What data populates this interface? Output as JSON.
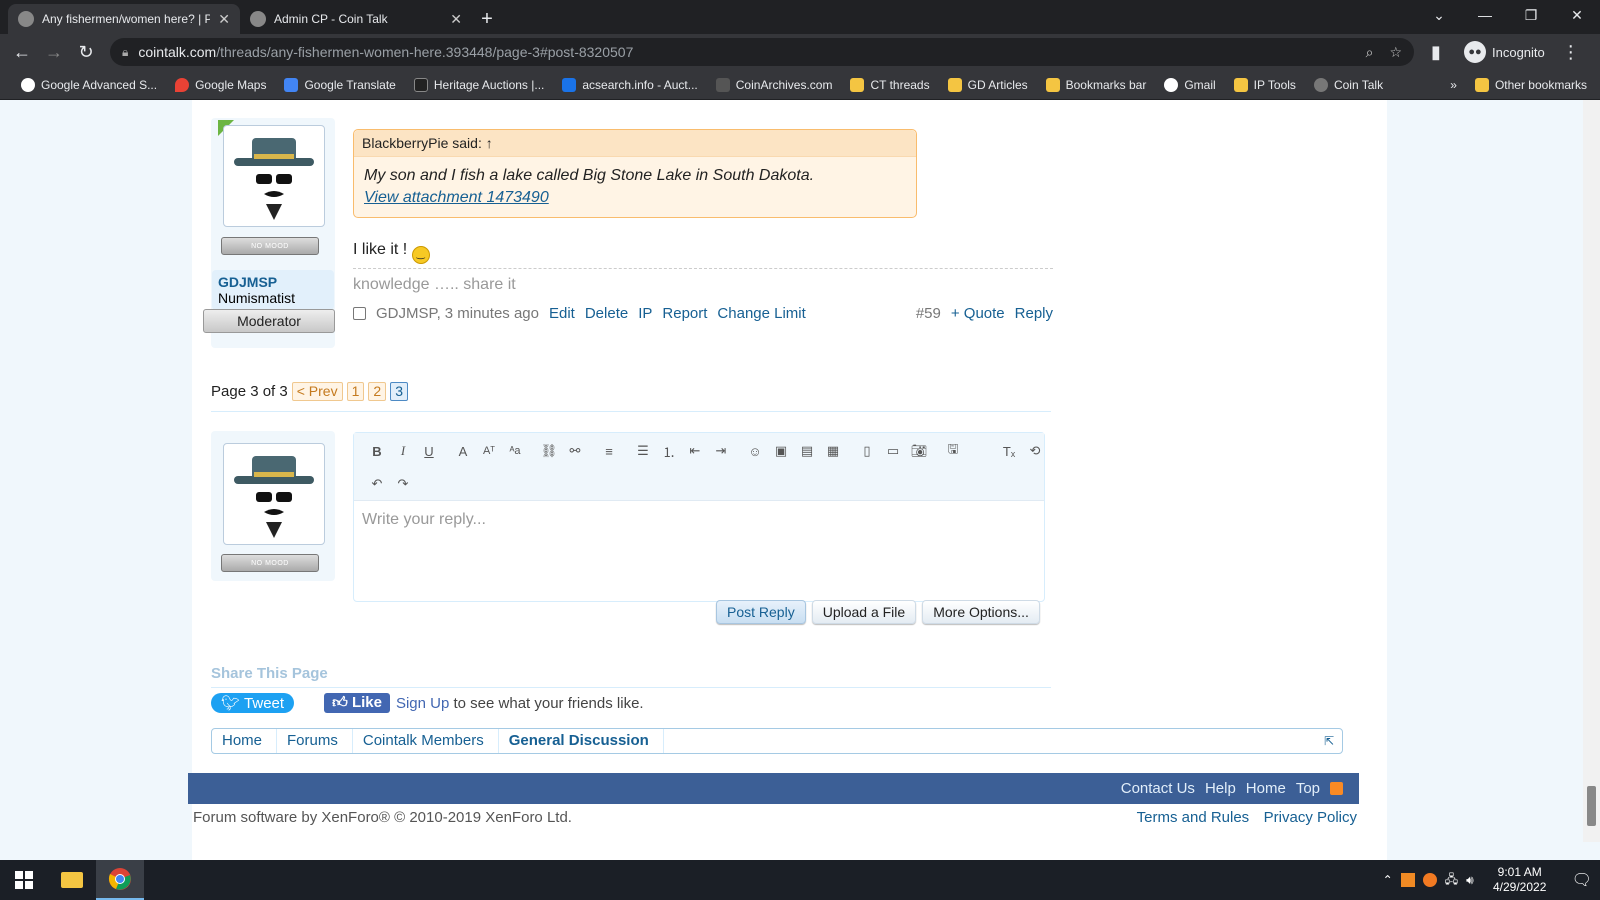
{
  "browser": {
    "tabs": [
      {
        "title": "Any fishermen/women here? | Pa",
        "active": true
      },
      {
        "title": "Admin CP - Coin Talk",
        "active": false
      }
    ],
    "url_host": "cointalk.com",
    "url_path": "/threads/any-fishermen-women-here.393448/page-3#post-8320507",
    "incognito_label": "Incognito",
    "bookmarks": [
      {
        "label": "Google Advanced S...",
        "icon": "google-icon"
      },
      {
        "label": "Google Maps",
        "icon": "maps-icon"
      },
      {
        "label": "Google Translate",
        "icon": "translate-icon"
      },
      {
        "label": "Heritage Auctions |...",
        "icon": "ha-icon"
      },
      {
        "label": "acsearch.info - Auct...",
        "icon": "acsearch-icon"
      },
      {
        "label": "CoinArchives.com",
        "icon": "ca-icon"
      },
      {
        "label": "CT threads",
        "icon": "folder-icon"
      },
      {
        "label": "GD Articles",
        "icon": "folder-icon"
      },
      {
        "label": "Bookmarks bar",
        "icon": "folder-icon"
      },
      {
        "label": "Gmail",
        "icon": "google-icon"
      },
      {
        "label": "IP Tools",
        "icon": "folder-icon"
      },
      {
        "label": "Coin Talk",
        "icon": "cointalk-icon"
      }
    ],
    "more_bookmarks": "»",
    "other_bookmarks": "Other bookmarks"
  },
  "post": {
    "mood": "NO MOOD",
    "username": "GDJMSP",
    "user_title": "Numismatist",
    "banner": "Moderator",
    "quote_author": "BlackberryPie said:",
    "quote_arrow": "↑",
    "quote_text": "My son and I fish a lake called Big Stone Lake in South Dakota.",
    "quote_attachment": "View attachment 1473490",
    "message": "I like it !",
    "signature": "knowledge ….. share it",
    "meta_author": "GDJMSP,",
    "meta_time": "3 minutes ago",
    "actions": [
      "Edit",
      "Delete",
      "IP",
      "Report",
      "Change Limit"
    ],
    "post_number": "#59",
    "quote_btn": "+ Quote",
    "reply_btn": "Reply"
  },
  "pager": {
    "label": "Page 3 of 3",
    "prev": "< Prev",
    "pages": [
      "1",
      "2",
      "3"
    ],
    "current": "3"
  },
  "reply": {
    "mood": "NO MOOD",
    "placeholder": "Write your reply...",
    "post_reply": "Post Reply",
    "upload": "Upload a File",
    "more_options": "More Options..."
  },
  "share": {
    "title": "Share This Page",
    "tweet": "Tweet",
    "like": "Like",
    "signup": "Sign Up",
    "signup_rest": " to see what your friends like."
  },
  "breadcrumb": [
    "Home",
    "Forums",
    "Cointalk Members",
    "General Discussion"
  ],
  "footer": {
    "links": [
      "Contact Us",
      "Help",
      "Home",
      "Top"
    ],
    "copyright": "Forum software by XenForo® © 2010-2019 XenForo Ltd.",
    "terms": "Terms and Rules",
    "privacy": "Privacy Policy"
  },
  "taskbar": {
    "time": "9:01 AM",
    "date": "4/29/2022"
  },
  "colors": {
    "accent": "#176093",
    "footer": "#3c5f96",
    "quote_border": "#f9bc6d"
  }
}
